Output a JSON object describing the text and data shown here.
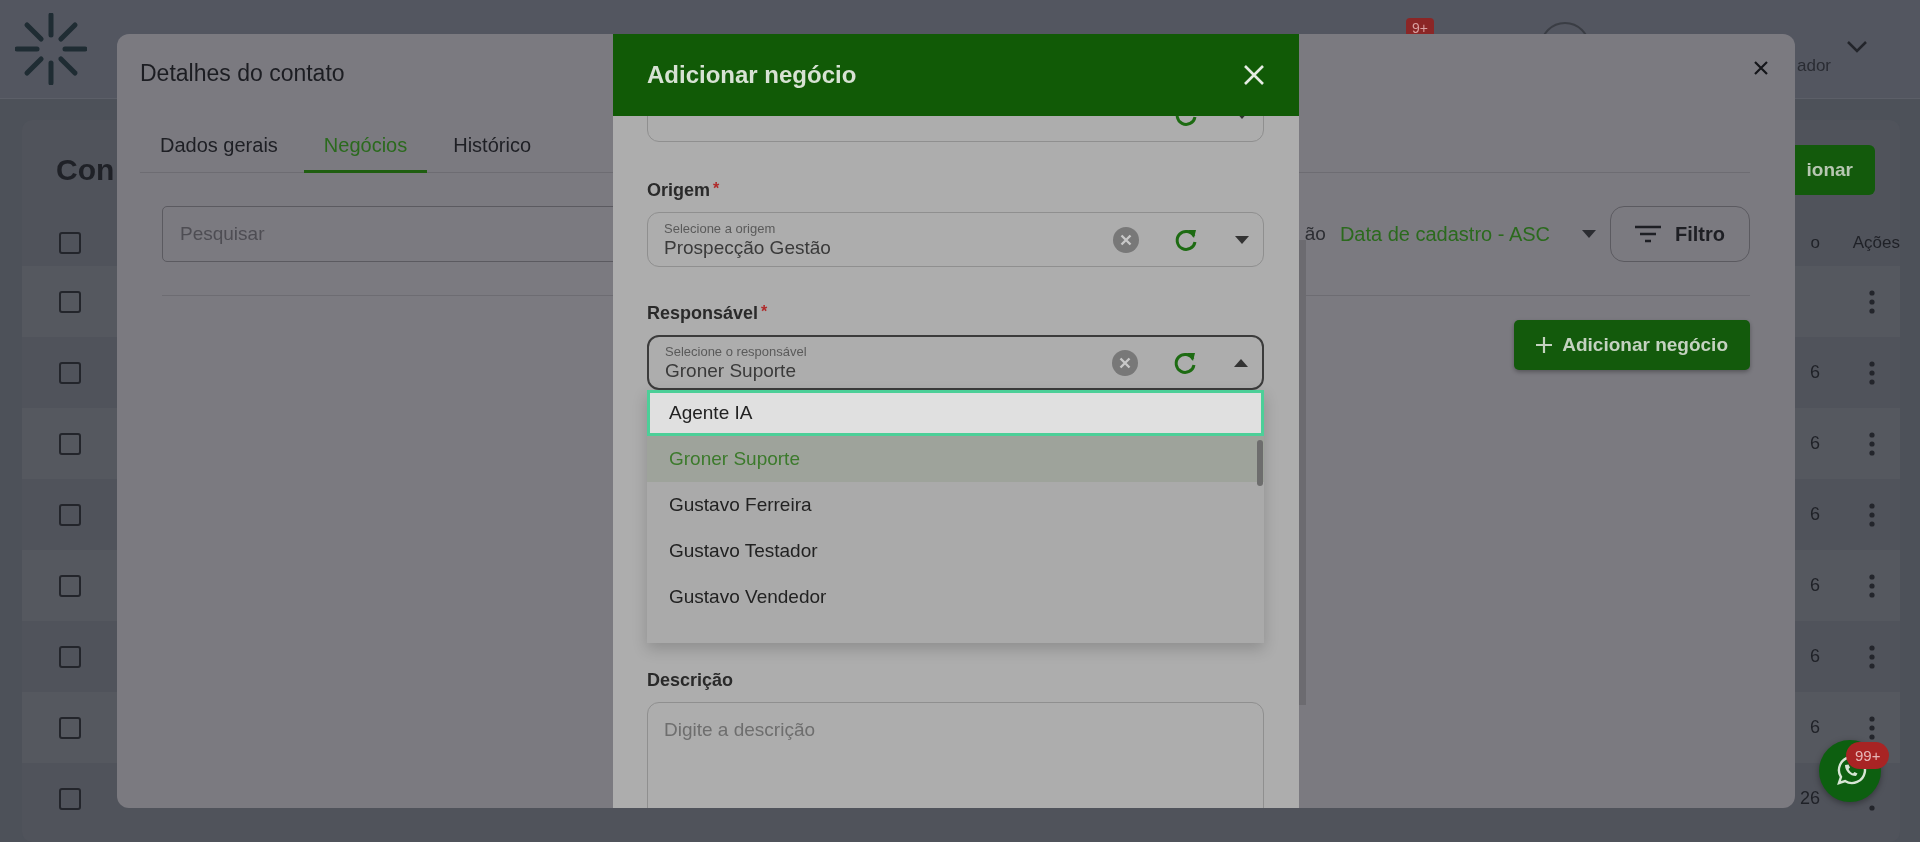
{
  "header": {
    "notification_badge": "9+",
    "user_role": "ador"
  },
  "contacts_page": {
    "title": "Con",
    "add_button": "ionar",
    "columns": [
      "o",
      "Ações"
    ],
    "header_checkbox": {
      "checked": false
    },
    "rows": [
      {
        "checked": false
      },
      {
        "checked": false,
        "date": "6"
      },
      {
        "checked": false,
        "date": "6"
      },
      {
        "checked": false,
        "date": "6"
      },
      {
        "checked": false,
        "date": "6"
      },
      {
        "checked": false,
        "date": "6"
      },
      {
        "checked": false,
        "date": "6"
      },
      {
        "checked": false,
        "date": "26"
      }
    ]
  },
  "contact_dialog": {
    "title": "Detalhes do contato",
    "tabs": [
      {
        "label": "Dados gerais",
        "selected": false
      },
      {
        "label": "Negócios",
        "selected": true
      },
      {
        "label": "Histórico",
        "selected": false
      }
    ],
    "search": {
      "placeholder": "Pesquisar"
    },
    "sort": {
      "label": "ão",
      "value": "Data de cadastro - ASC"
    },
    "filter_button": "Filtro",
    "add_deal_button": "Adicionar negócio"
  },
  "add_deal_dialog": {
    "title": "Adicionar negócio",
    "fields": [
      {
        "kind": "select",
        "open": false
      },
      {
        "kind": "select",
        "label": "Origem",
        "required_mark": "*",
        "floating_label": "Selecione a origem",
        "value": "Prospecção Gestão",
        "open": false
      },
      {
        "kind": "select",
        "label": "Responsável",
        "required_mark": "*",
        "floating_label": "Selecione o responsável",
        "value": "Groner Suporte",
        "open": true,
        "options": [
          {
            "label": "Agente IA",
            "highlighted": true,
            "selected": false
          },
          {
            "label": "Groner Suporte",
            "highlighted": false,
            "selected": true
          },
          {
            "label": "Gustavo Ferreira",
            "highlighted": false,
            "selected": false
          },
          {
            "label": "Gustavo Testador",
            "highlighted": false,
            "selected": false
          },
          {
            "label": "Gustavo Vendedor",
            "highlighted": false,
            "selected": false
          }
        ]
      },
      {
        "kind": "textarea",
        "label": "Descrição",
        "placeholder": "Digite a descrição"
      }
    ]
  },
  "chat_button": {
    "badge": "99+"
  }
}
